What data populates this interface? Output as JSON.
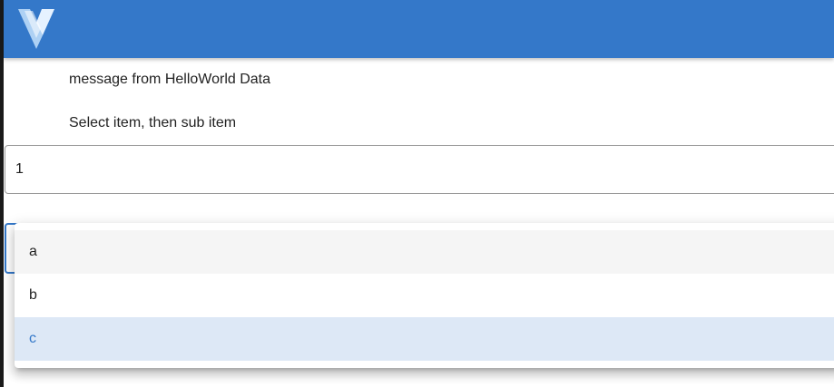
{
  "colors": {
    "app_bar": "#3478c9",
    "accent": "#3478c9",
    "selected_item_bg": "#dde8f6",
    "hover_item_bg": "#f5f5f5"
  },
  "app_bar": {
    "logo_icon": "vuetify-logo-icon"
  },
  "main": {
    "message": "message from HelloWorld Data",
    "instruction": "Select item, then sub item"
  },
  "item_select": {
    "value": "1"
  },
  "sub_item_select": {
    "menu_open": true,
    "options": [
      {
        "label": "a",
        "state": "hovered"
      },
      {
        "label": "b",
        "state": "normal"
      },
      {
        "label": "c",
        "state": "selected"
      }
    ]
  }
}
